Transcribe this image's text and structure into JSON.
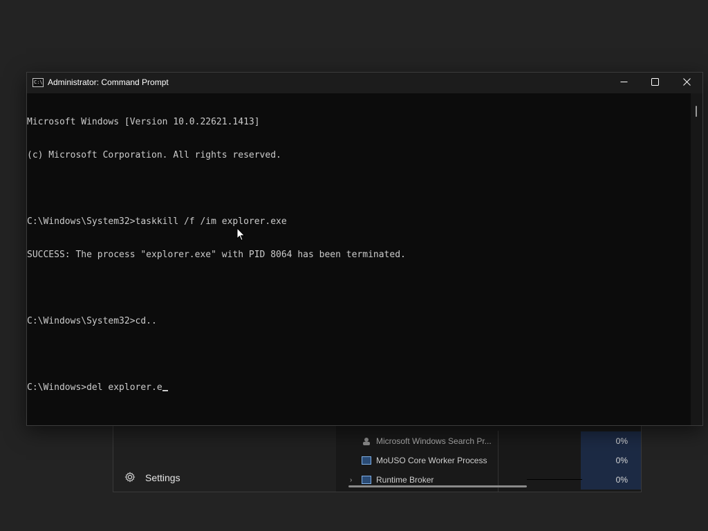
{
  "cmd": {
    "title": "Administrator: Command Prompt",
    "lines": [
      "Microsoft Windows [Version 10.0.22621.1413]",
      "(c) Microsoft Corporation. All rights reserved.",
      "",
      "C:\\Windows\\System32>taskkill /f /im explorer.exe",
      "SUCCESS: The process \"explorer.exe\" with PID 8064 has been terminated.",
      "",
      "C:\\Windows\\System32>cd..",
      "",
      "C:\\Windows>del explorer.e"
    ],
    "icon": "cmd-app-icon",
    "buttons": {
      "minimize_icon": "minimize-icon",
      "maximize_icon": "maximize-icon",
      "close_icon": "close-icon"
    }
  },
  "taskmgr": {
    "settings_label": "Settings",
    "settings_icon": "gear-icon",
    "rows": [
      {
        "name": "Microsoft Windows Search Pr...",
        "cpu": "0%",
        "expandable": false,
        "icon": "search-indexer-icon"
      },
      {
        "name": "MoUSO Core Worker Process",
        "cpu": "0%",
        "expandable": false,
        "icon": "window-icon"
      },
      {
        "name": "Runtime Broker",
        "cpu": "0%",
        "expandable": true,
        "icon": "window-icon"
      }
    ],
    "accent_cpu_bg": "#1c2a44"
  },
  "colors": {
    "console_bg": "#0c0c0c",
    "console_text": "#cccccc",
    "titlebar_bg": "#1c1c1c"
  }
}
